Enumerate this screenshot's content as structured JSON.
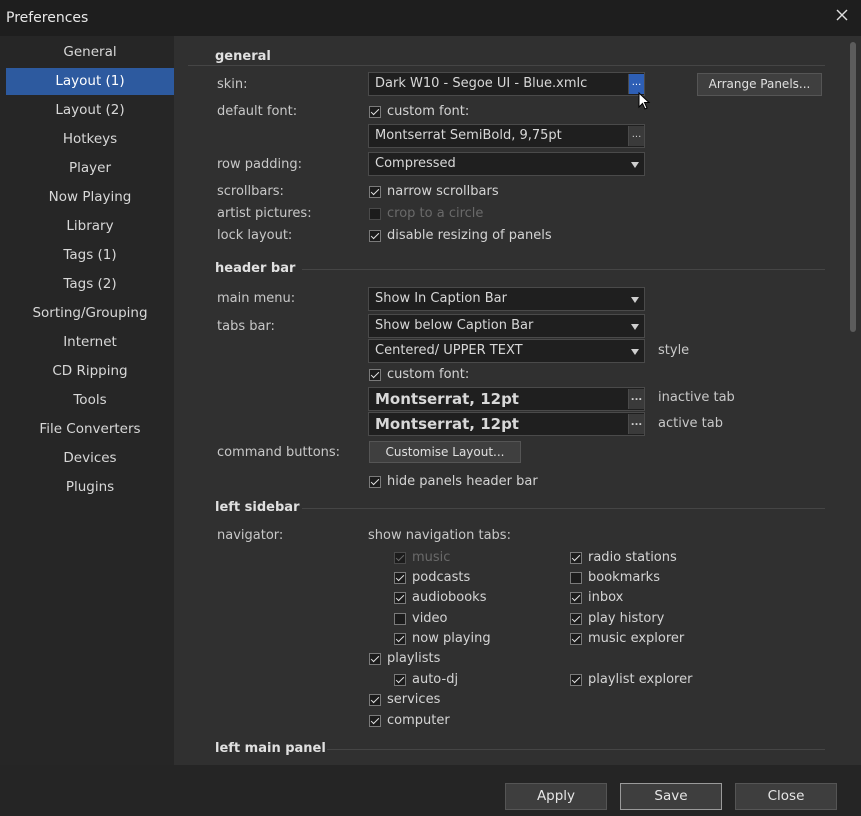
{
  "window": {
    "title": "Preferences"
  },
  "sidebar": {
    "items": [
      {
        "label": "General"
      },
      {
        "label": "Layout (1)",
        "active": true
      },
      {
        "label": "Layout (2)"
      },
      {
        "label": "Hotkeys"
      },
      {
        "label": "Player"
      },
      {
        "label": "Now Playing"
      },
      {
        "label": "Library"
      },
      {
        "label": "Tags (1)"
      },
      {
        "label": "Tags (2)"
      },
      {
        "label": "Sorting/Grouping"
      },
      {
        "label": "Internet"
      },
      {
        "label": "CD Ripping"
      },
      {
        "label": "Tools"
      },
      {
        "label": "File Converters"
      },
      {
        "label": "Devices"
      },
      {
        "label": "Plugins"
      }
    ]
  },
  "general": {
    "heading": "general",
    "skin_label": "skin:",
    "skin_value": "Dark W10 - Segoe UI - Blue.xmlc",
    "browse": "...",
    "arrange_panels": "Arrange Panels...",
    "default_font_label": "default font:",
    "custom_font": "custom font:",
    "font_value": "Montserrat SemiBold, 9,75pt",
    "row_padding_label": "row padding:",
    "row_padding_value": "Compressed",
    "scrollbars_label": "scrollbars:",
    "narrow_scrollbars": "narrow scrollbars",
    "artist_pictures_label": "artist pictures:",
    "crop_circle": "crop to a circle",
    "lock_layout_label": "lock layout:",
    "disable_resizing": "disable resizing of panels"
  },
  "header_bar": {
    "heading": "header bar",
    "main_menu_label": "main menu:",
    "main_menu_value": "Show In Caption Bar",
    "tabs_bar_label": "tabs bar:",
    "tabs_bar_value": "Show below Caption Bar",
    "style_value": "Centered/ UPPER TEXT",
    "style_label": "style",
    "custom_font": "custom font:",
    "inactive_font": "Montserrat, 12pt",
    "inactive_label": "inactive tab",
    "active_font": "Montserrat, 12pt",
    "active_label": "active tab",
    "command_buttons_label": "command buttons:",
    "customise_layout": "Customise Layout...",
    "hide_panels_header": "hide panels header bar"
  },
  "left_sidebar": {
    "heading": "left sidebar",
    "navigator_label": "navigator:",
    "show_nav_tabs": "show navigation tabs:",
    "music": "music",
    "podcasts": "podcasts",
    "audiobooks": "audiobooks",
    "video": "video",
    "now_playing": "now playing",
    "playlists": "playlists",
    "auto_dj": "auto-dj",
    "services": "services",
    "computer": "computer",
    "radio_stations": "radio stations",
    "bookmarks": "bookmarks",
    "inbox": "inbox",
    "play_history": "play history",
    "music_explorer": "music explorer",
    "playlist_explorer": "playlist explorer"
  },
  "left_main_panel": {
    "heading": "left main panel"
  },
  "footer": {
    "apply": "Apply",
    "save": "Save",
    "close": "Close"
  },
  "colors": {
    "accent": "#2d5a9f",
    "background": "#303030",
    "sidebar": "#262626"
  }
}
